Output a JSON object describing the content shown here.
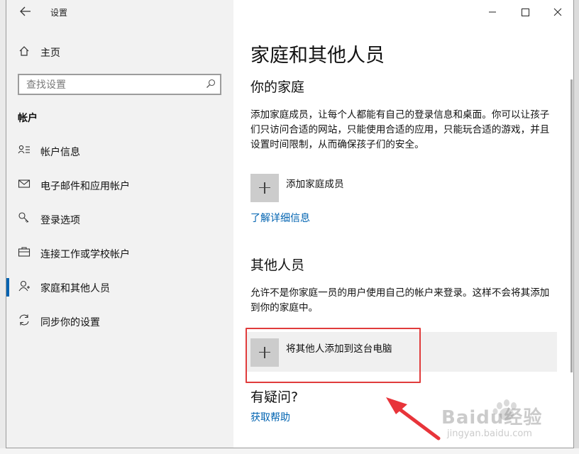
{
  "window": {
    "title": "设置"
  },
  "sidebar": {
    "home_label": "主页",
    "search_placeholder": "查找设置",
    "section_label": "帐户",
    "items": [
      {
        "label": "帐户信息",
        "icon": "account-info-icon"
      },
      {
        "label": "电子邮件和应用帐户",
        "icon": "mail-icon"
      },
      {
        "label": "登录选项",
        "icon": "key-icon"
      },
      {
        "label": "连接工作或学校帐户",
        "icon": "briefcase-icon"
      },
      {
        "label": "家庭和其他人员",
        "icon": "person-icon",
        "active": true
      },
      {
        "label": "同步你的设置",
        "icon": "sync-icon"
      }
    ]
  },
  "main": {
    "page_title": "家庭和其他人员",
    "family": {
      "heading": "你的家庭",
      "description": "添加家庭成员，让每个人都能有自己的登录信息和桌面。你可以让孩子们只访问合适的网站，只能使用合适的应用，只能玩合适的游戏，并且设置时间限制，从而确保孩子们的安全。",
      "add_label": "添加家庭成员",
      "learn_more": "了解详细信息"
    },
    "others": {
      "heading": "其他人员",
      "description": "允许不是你家庭一员的用户使用自己的帐户来登录。这样不会将其添加到你的家庭中。",
      "add_label": "将其他人添加到这台电脑"
    },
    "help": {
      "heading": "有疑问?",
      "link": "获取帮助"
    }
  },
  "watermark": {
    "brand": "Baidu经验",
    "url": "jingyan.baidu.com"
  },
  "colors": {
    "accent": "#0063b1",
    "highlight_border": "#e03c3c",
    "arrow": "#e8343a",
    "sidebar_bg": "#f2f2f2"
  }
}
